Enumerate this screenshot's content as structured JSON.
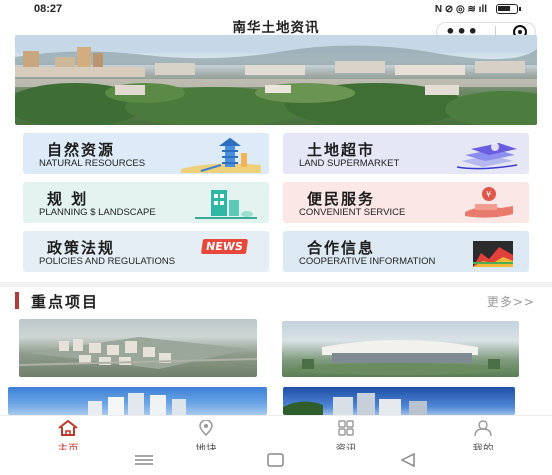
{
  "status_bar": {
    "time": "08:27",
    "icons_text": "N ⊘ ◎ ≋ ıll"
  },
  "header": {
    "title": "南华土地资讯",
    "capsule": {
      "more_icon": "•••",
      "close_icon": "target-icon"
    }
  },
  "categories": [
    {
      "cn": "自然资源",
      "en": "NATURAL RESOURCES",
      "bg": "#dcebf7",
      "icon": "pagoda-icon"
    },
    {
      "cn": "土地超市",
      "en": "LAND SUPERMARKET",
      "bg": "#e6e7f6",
      "icon": "card-stack-icon"
    },
    {
      "cn": "规  划",
      "en": "PLANNING $ LANDSCAPE",
      "bg": "#e3f3ef",
      "icon": "building-icon"
    },
    {
      "cn": "便民服务",
      "en": "CONVENIENT SERVICE",
      "bg": "#fbe7e5",
      "icon": "coin-hand-icon"
    },
    {
      "cn": "政策法规",
      "en": "POLICIES AND REGULATIONS",
      "bg": "#e4eef4",
      "icon": "news-icon",
      "badge": "NEWS"
    },
    {
      "cn": "合作信息",
      "en": "COOPERATIVE INFORMATION",
      "bg": "#dde9f2",
      "icon": "chart-icon"
    }
  ],
  "section": {
    "title": "重点项目",
    "more": "更多>>"
  },
  "tabbar": [
    {
      "label": "主页",
      "icon": "home-icon",
      "active": true
    },
    {
      "label": "地块",
      "icon": "location-pin-icon",
      "active": false
    },
    {
      "label": "资讯",
      "icon": "grid-icon",
      "active": false
    },
    {
      "label": "我的",
      "icon": "user-icon",
      "active": false
    }
  ],
  "colors": {
    "accent": "#c0392b",
    "section_bar": "#b33a3a"
  }
}
